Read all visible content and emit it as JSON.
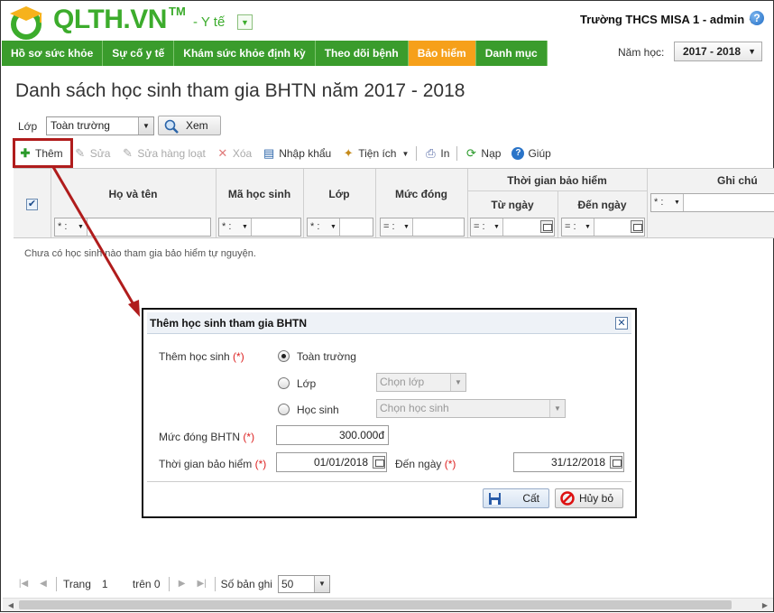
{
  "header": {
    "logo_text": "QLTH.VN",
    "logo_tm": "TM",
    "module": "- Y tế",
    "school": "Trường THCS MISA 1",
    "user": "admin",
    "help_icon": "?"
  },
  "nav": {
    "items": [
      "Hồ sơ sức khỏe",
      "Sự cố y tế",
      "Khám sức khỏe định kỳ",
      "Theo dõi bệnh",
      "Bảo hiểm",
      "Danh mục"
    ],
    "active_index": 4,
    "year_label": "Năm học:",
    "year_value": "2017 - 2018"
  },
  "page": {
    "title": "Danh sách học sinh tham gia BHTN năm 2017 - 2018",
    "class_label": "Lớp",
    "class_value": "Toàn trường",
    "view_button": "Xem"
  },
  "toolbar": {
    "add": "Thêm",
    "edit": "Sửa",
    "edit_batch": "Sửa hàng loạt",
    "delete": "Xóa",
    "import": "Nhập khẩu",
    "utilities": "Tiện ích",
    "print": "In",
    "load": "Nạp",
    "help": "Giúp"
  },
  "grid": {
    "columns": {
      "name": "Họ và tên",
      "student_code": "Mã học sinh",
      "class": "Lớp",
      "fee": "Mức đóng",
      "insurance_period": "Thời gian bảo hiểm",
      "from_date": "Từ ngày",
      "to_date": "Đến ngày",
      "note": "Ghi chú"
    },
    "filter_ops": {
      "name": "* :",
      "student_code": "* :",
      "class": "* :",
      "fee": "= :",
      "from_date": "= :",
      "to_date": "= :",
      "note": "* :"
    },
    "empty_message": "Chưa có học sinh nào tham gia bảo hiểm tự nguyện."
  },
  "dialog": {
    "title": "Thêm học sinh tham gia BHTN",
    "add_student_label": "Thêm học sinh",
    "required_mark": "(*)",
    "option_all": "Toàn trường",
    "option_class": "Lớp",
    "option_student": "Học sinh",
    "class_placeholder": "Chọn lớp",
    "student_placeholder": "Chọn học sinh",
    "fee_label": "Mức đóng BHTN",
    "fee_value": "300.000đ",
    "period_label": "Thời gian bảo hiểm",
    "from_date": "01/01/2018",
    "to_label": "Đến ngày",
    "to_date": "31/12/2018",
    "save_button": "Cất",
    "cancel_button": "Hủy bỏ"
  },
  "pager": {
    "page_label": "Trang",
    "page_value": "1",
    "of_label": "trên 0",
    "records_label": "Số bản ghi",
    "records_value": "50"
  }
}
